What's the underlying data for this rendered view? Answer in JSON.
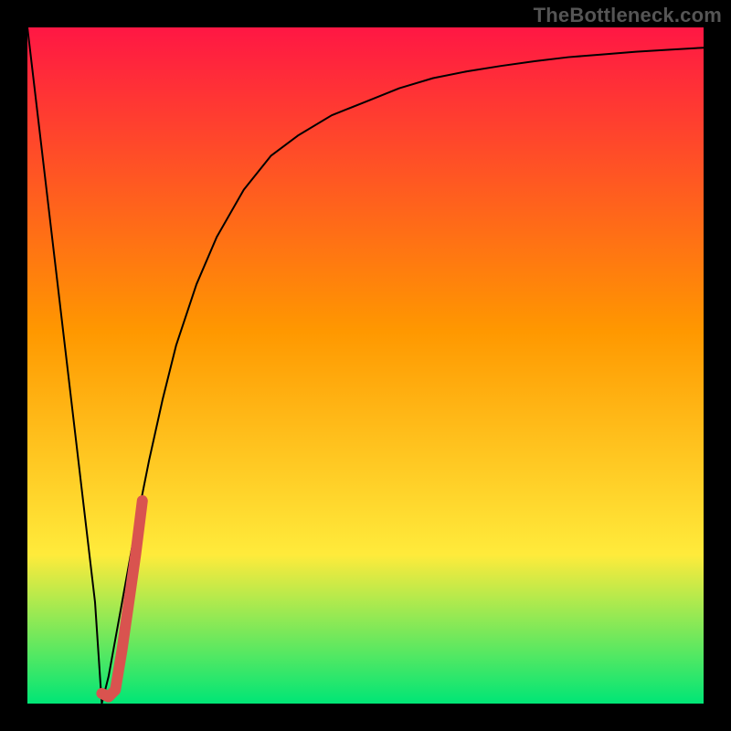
{
  "watermark": "TheBottleneck.com",
  "chart_data": {
    "type": "line",
    "title": "",
    "xlabel": "",
    "ylabel": "",
    "xlim": [
      0,
      100
    ],
    "ylim": [
      0,
      100
    ],
    "grid": false,
    "legend": false,
    "background_gradient": {
      "top_color": "#ff1744",
      "mid_color_1": "#ff9800",
      "mid_color_2": "#ffeb3b",
      "bottom_color": "#00e676"
    },
    "series": [
      {
        "name": "bottleneck-curve",
        "color": "#000000",
        "width": 2,
        "x": [
          0,
          2,
          4,
          6,
          8,
          10,
          11,
          12,
          14,
          16,
          18,
          20,
          22,
          25,
          28,
          32,
          36,
          40,
          45,
          50,
          55,
          60,
          65,
          70,
          75,
          80,
          85,
          90,
          95,
          100
        ],
        "y": [
          100,
          83,
          66,
          49,
          32,
          15,
          0,
          4,
          15,
          26,
          36,
          45,
          53,
          62,
          69,
          76,
          81,
          84,
          87,
          89,
          91,
          92.5,
          93.5,
          94.3,
          95,
          95.6,
          96,
          96.4,
          96.7,
          97
        ]
      },
      {
        "name": "highlight-segment",
        "color": "#d9534f",
        "width": 12,
        "linecap": "round",
        "x": [
          11,
          12,
          13,
          14,
          15,
          16,
          17
        ],
        "y": [
          1.5,
          1,
          2,
          8,
          15,
          22,
          30
        ]
      }
    ]
  }
}
